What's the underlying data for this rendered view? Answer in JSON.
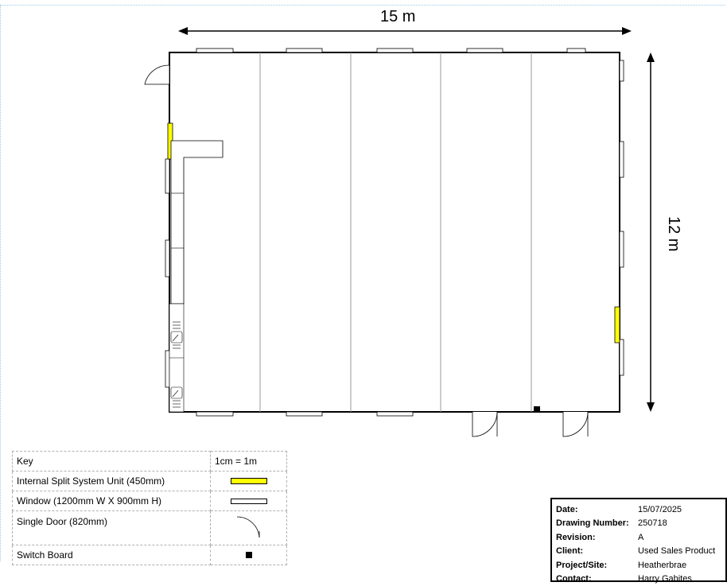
{
  "dimensions": {
    "width": "15 m",
    "height": "12 m"
  },
  "key": {
    "header": {
      "label": "Key",
      "scale": "1cm = 1m"
    },
    "rows": [
      {
        "label": "Internal Split System Unit (450mm)",
        "symbol": "split-system-icon"
      },
      {
        "label": "Window (1200mm W X 900mm H)",
        "symbol": "window-icon"
      },
      {
        "label": "Single Door (820mm)",
        "symbol": "door-icon"
      },
      {
        "label": "Switch Board",
        "symbol": "switch-board-icon"
      }
    ]
  },
  "title_block": {
    "rows": [
      {
        "key": "Date:",
        "value": "15/07/2025"
      },
      {
        "key": "Drawing Number:",
        "value": "250718"
      },
      {
        "key": "Revision:",
        "value": "A"
      },
      {
        "key": "Client:",
        "value": "Used Sales Product"
      },
      {
        "key": "Project/Site:",
        "value": "Heatherbrae"
      },
      {
        "key": "Contact:",
        "value": "Harry Gabites"
      }
    ]
  },
  "colors": {
    "split_system": "#ffff00",
    "wall": "#000000",
    "grid_line": "#999999"
  }
}
